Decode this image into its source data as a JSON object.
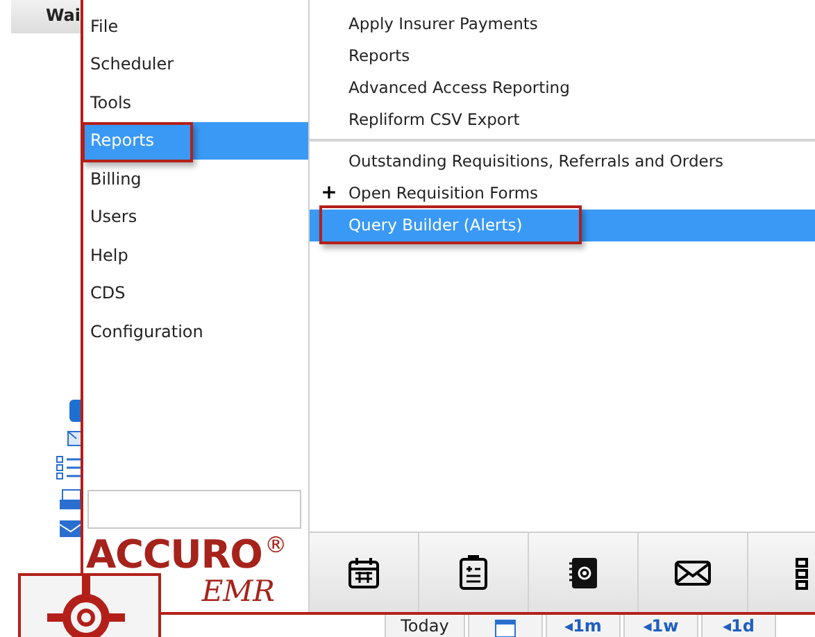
{
  "header_tab": "Wai",
  "menu": {
    "items": [
      {
        "label": "File",
        "selected": false,
        "annotated": false
      },
      {
        "label": "Scheduler",
        "selected": false,
        "annotated": false
      },
      {
        "label": "Tools",
        "selected": false,
        "annotated": false
      },
      {
        "label": "Reports",
        "selected": true,
        "annotated": true
      },
      {
        "label": "Billing",
        "selected": false,
        "annotated": false
      },
      {
        "label": "Users",
        "selected": false,
        "annotated": false
      },
      {
        "label": "Help",
        "selected": false,
        "annotated": false
      },
      {
        "label": "CDS",
        "selected": false,
        "annotated": false
      },
      {
        "label": "Configuration",
        "selected": false,
        "annotated": false
      }
    ]
  },
  "submenu": {
    "sections": [
      [
        {
          "label": "Apply Insurer Payments",
          "kind": "item",
          "selected": false,
          "annotated": false
        },
        {
          "label": "Reports",
          "kind": "item",
          "selected": false,
          "annotated": false
        },
        {
          "label": "Advanced Access Reporting",
          "kind": "item",
          "selected": false,
          "annotated": false
        },
        {
          "label": "Repliform CSV Export",
          "kind": "item",
          "selected": false,
          "annotated": false
        }
      ],
      [
        {
          "label": "Outstanding Requisitions, Referrals and Orders",
          "kind": "item",
          "selected": false,
          "annotated": false
        },
        {
          "label": "Open Requisition Forms",
          "kind": "expandable",
          "expander": "+",
          "selected": false,
          "annotated": false
        },
        {
          "label": "Query Builder (Alerts)",
          "kind": "item",
          "selected": true,
          "annotated": true
        }
      ]
    ]
  },
  "logo": {
    "name": "ACCURO",
    "mark": "®",
    "sub": "EMR",
    "annotated": true
  },
  "toolbar": [
    {
      "kind": "calendar"
    },
    {
      "kind": "notes"
    },
    {
      "kind": "contacts"
    },
    {
      "kind": "mail"
    },
    {
      "kind": "list"
    }
  ],
  "bottom_bar": [
    {
      "kind": "text",
      "label": "Today"
    },
    {
      "kind": "calendar"
    },
    {
      "kind": "text",
      "label": "◂1m"
    },
    {
      "kind": "text",
      "label": "◂1w"
    },
    {
      "kind": "text",
      "label": "◂1d"
    }
  ]
}
